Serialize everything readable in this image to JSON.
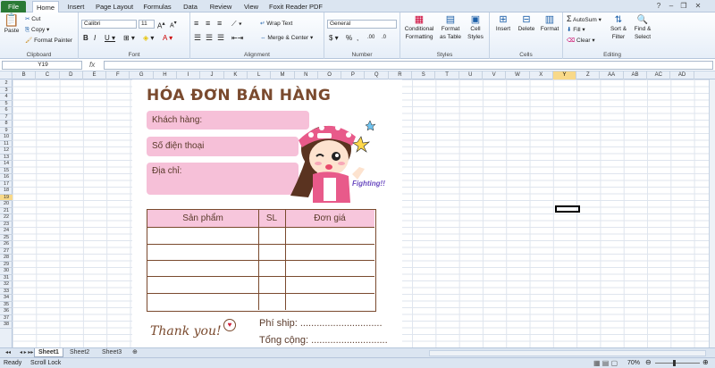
{
  "tabs": [
    "File",
    "Home",
    "Insert",
    "Page Layout",
    "Formulas",
    "Data",
    "Review",
    "View",
    "Foxit Reader PDF"
  ],
  "ribbon": {
    "clipboard": {
      "paste": "Paste",
      "cut": "Cut",
      "copy": "Copy",
      "painter": "Format Painter",
      "label": "Clipboard"
    },
    "font": {
      "name": "Calibri",
      "size": "11",
      "label": "Font"
    },
    "alignment": {
      "wrap": "Wrap Text",
      "merge": "Merge & Center",
      "label": "Alignment"
    },
    "number": {
      "format": "General",
      "label": "Number"
    },
    "styles": {
      "cond": "Conditional Formatting",
      "table": "Format as Table",
      "cell": "Cell Styles",
      "label": "Styles"
    },
    "cells": {
      "insert": "Insert",
      "delete": "Delete",
      "format": "Format",
      "label": "Cells"
    },
    "editing": {
      "autosum": "AutoSum",
      "fill": "Fill",
      "clear": "Clear",
      "sort": "Sort & Filter",
      "find": "Find & Select",
      "label": "Editing"
    }
  },
  "formula_bar": {
    "name_box": "Y19",
    "fx": "fx",
    "formula": ""
  },
  "columns": [
    "B",
    "C",
    "D",
    "E",
    "F",
    "G",
    "H",
    "I",
    "J",
    "K",
    "L",
    "M",
    "N",
    "O",
    "P",
    "Q",
    "R",
    "S",
    "T",
    "U",
    "V",
    "W",
    "X",
    "Y",
    "Z",
    "AA",
    "AB",
    "AC",
    "AD"
  ],
  "selected_column": "Y",
  "rows": [
    "2",
    "3",
    "4",
    "5",
    "6",
    "7",
    "8",
    "9",
    "10",
    "11",
    "12",
    "13",
    "14",
    "15",
    "16",
    "17",
    "18",
    "19",
    "20",
    "21",
    "22",
    "23",
    "24",
    "25",
    "26",
    "27",
    "28",
    "29",
    "30",
    "31",
    "32",
    "33",
    "34",
    "35",
    "36",
    "37",
    "38"
  ],
  "selected_row": "19",
  "invoice": {
    "title": "HÓA ĐƠN BÁN HÀNG",
    "customer": "Khách hàng:",
    "phone": "Số điện thoại",
    "address": "Địa chỉ:",
    "table_headers": [
      "Sản phẩm",
      "SL",
      "Đơn giá"
    ],
    "shipping": "Phí ship: ..............................",
    "total": "Tổng cộng: ............................",
    "thank_you": "Thank you!",
    "fighting": "Fighting!!"
  },
  "sheets": [
    "Sheet1",
    "Sheet2",
    "Sheet3"
  ],
  "active_sheet": "Sheet1",
  "status": {
    "ready": "Ready",
    "scroll": "Scroll Lock",
    "zoom": "70%"
  },
  "colors": {
    "pink": "#f6c0d8",
    "header_pink": "#f7c6dc",
    "brown": "#7a4a2e",
    "file_green": "#2a7a35"
  }
}
